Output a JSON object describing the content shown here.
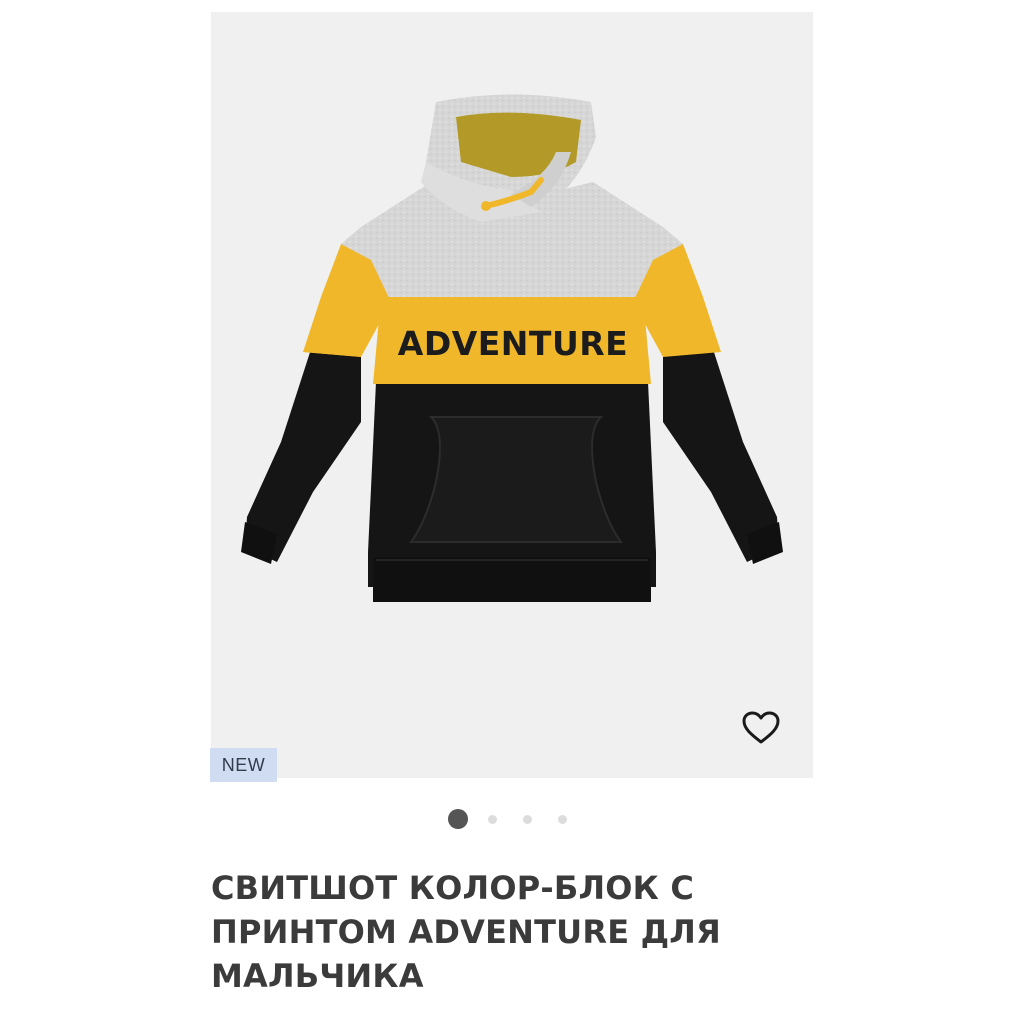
{
  "product": {
    "badge": "NEW",
    "title": "СВИТШОТ КОЛОР-БЛОК С ПРИНТОМ ADVENTURE ДЛЯ МАЛЬЧИКА",
    "print_text": "ADVENTURE",
    "favorite_icon": "heart-outline-icon",
    "colors": {
      "background": "#f0f0f0",
      "grey_melange": "#d9d9d9",
      "mustard": "#f0b72a",
      "black": "#141414",
      "badge_bg": "#cfdcf2"
    }
  },
  "gallery": {
    "total_slides": 4,
    "active_slide": 1
  }
}
